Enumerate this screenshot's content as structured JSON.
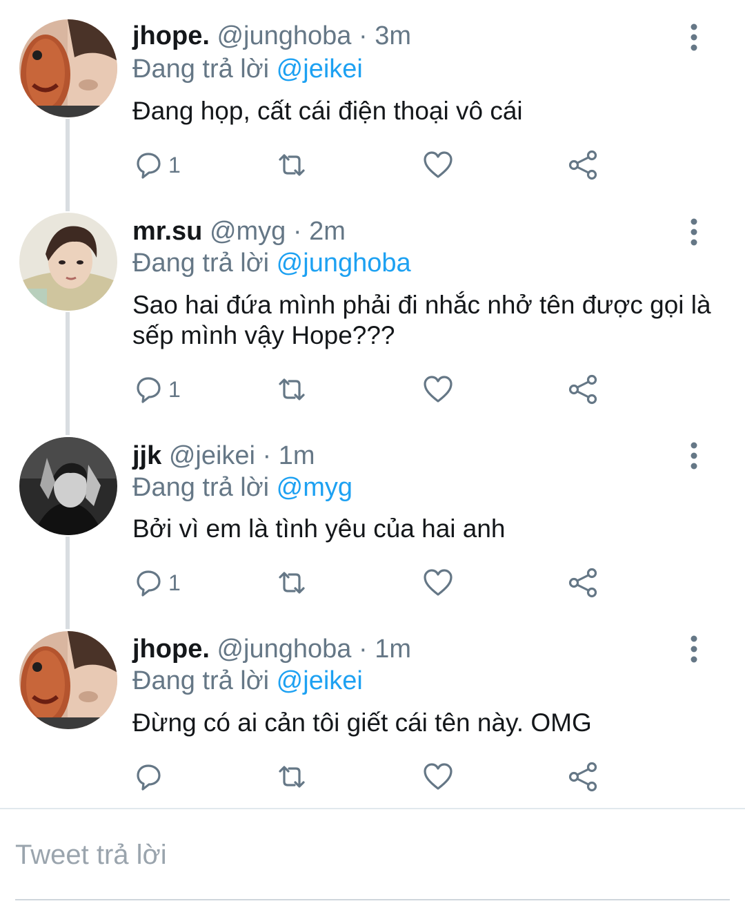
{
  "tweets": [
    {
      "name": "jhope.",
      "handle": "@junghoba",
      "time": "· 3m",
      "replying_label": "Đang trả lời",
      "replying_to": "@jeikei",
      "text": "Đang họp, cất cái điện thoại vô cái",
      "reply_count": "1",
      "avatar": "jhope-avatar-mask"
    },
    {
      "name": "mr.su",
      "handle": "@myg",
      "time": "· 2m",
      "replying_label": "Đang trả lời",
      "replying_to": "@junghoba",
      "text": "Sao hai đứa mình phải đi nhắc nhở tên được gọi là sếp mình vậy Hope???",
      "reply_count": "1",
      "avatar": "mrsu-avatar"
    },
    {
      "name": "jjk",
      "handle": "@jeikei",
      "time": "· 1m",
      "replying_label": "Đang trả lời",
      "replying_to": "@myg",
      "text": "Bởi vì em là tình yêu của hai anh",
      "reply_count": "1",
      "avatar": "jjk-avatar-bw"
    },
    {
      "name": "jhope.",
      "handle": "@junghoba",
      "time": "· 1m",
      "replying_label": "Đang trả lời",
      "replying_to": "@jeikei",
      "text": "Đừng có ai cản tôi giết cái tên này. OMG",
      "reply_count": "",
      "avatar": "jhope-avatar-mask"
    }
  ],
  "icons": {
    "reply": "reply-icon",
    "retweet": "retweet-icon",
    "like": "heart-icon",
    "share": "share-icon",
    "more": "more-vertical-icon"
  },
  "composer": {
    "placeholder": "Tweet trả lời"
  },
  "colors": {
    "mention": "#1da1f2",
    "secondary_text": "#657786",
    "icon": "#657786",
    "thread_line": "#d9dde1"
  }
}
